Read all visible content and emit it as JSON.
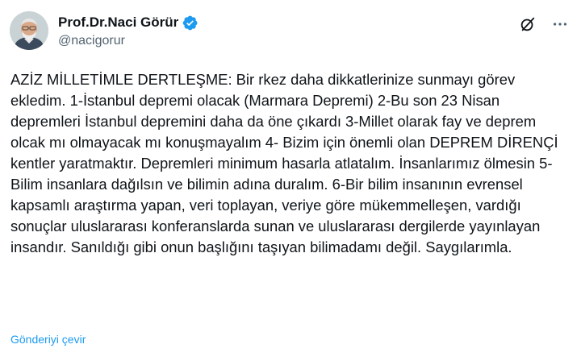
{
  "author": {
    "display_name": "Prof.Dr.Naci Görür",
    "handle": "@nacigorur",
    "verified": true,
    "verified_color": "#1d9bf0"
  },
  "icons": {
    "verified": "verified-badge-icon",
    "grok": "grok-icon",
    "more": "more-options-icon"
  },
  "tweet": {
    "text": "AZİZ MİLLETİMLE DERTLEŞME: Bir rkez daha dikkatlerinize sunmayı görev ekledim. 1-İstanbul depremi olacak (Marmara Depremi) 2-Bu son 23 Nisan depremleri İstanbul depremini daha da öne çıkardı 3-Millet olarak fay ve deprem olcak mı olmayacak mı konuşmayalım 4- Bizim için önemli olan DEPREM DİRENÇİ kentler yaratmaktır. Depremleri minimum hasarla atlatalım. İnsanlarımız ölmesin 5-Bilim insanlara dağılsın ve bilimin adına duralım. 6-Bir bilim insanının evrensel kapsamlı araştırma yapan, veri toplayan, veriye göre mükemmelleşen, vardığı sonuçlar uluslararası konferanslarda sunan ve uluslararası dergilerde yayınlayan insandır. Sanıldığı gibi onun başlığını taşıyan bilimadamı değil. Saygılarımla.",
    "translate_label": "Gönderiyi çevir"
  },
  "colors": {
    "text": "#0f1419",
    "secondary": "#536471",
    "link": "#1d9bf0"
  }
}
